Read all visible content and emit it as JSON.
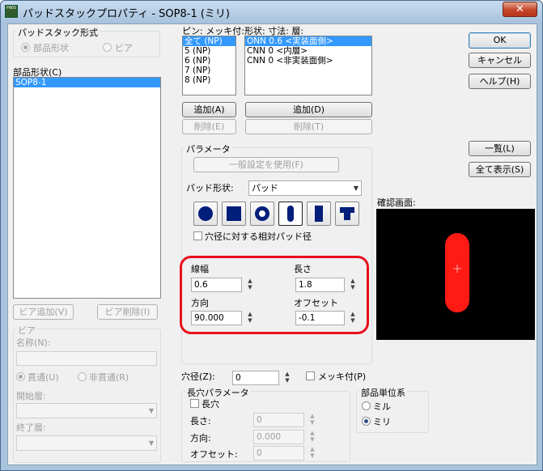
{
  "window": {
    "title": "パッドスタックプロパティ - SOP8-1 (ミリ)",
    "app_icon_text": "PADS",
    "close_glyph": "✕"
  },
  "padstack_type": {
    "group_label": "パッドスタック形式",
    "options": [
      "部品形状",
      "ビア"
    ],
    "selected": "部品形状"
  },
  "decal": {
    "label": "部品形状(C)",
    "items": [
      "SOP8-1"
    ],
    "selected": "SOP8-1"
  },
  "via_buttons": {
    "add": "ビア追加(V)",
    "delete": "ビア削除(I)"
  },
  "via_group": {
    "label": "ビア",
    "name_label": "名称(N):",
    "name_value": "",
    "through": "貫通(U)",
    "non_through": "非貫通(R)",
    "selected": "貫通(U)",
    "start_layer_label": "開始層:",
    "start_layer_value": "",
    "end_layer_label": "終了層:",
    "end_layer_value": ""
  },
  "pins": {
    "label": "ピン: メッキ付:",
    "items": [
      "全て (NP)",
      "5 (NP)",
      "6 (NP)",
      "7 (NP)",
      "8 (NP)"
    ],
    "selected": "全て (NP)"
  },
  "shapes": {
    "label": "形状: 寸法: 層:",
    "items": [
      "ONN 0.6 <実装面側>",
      "CNN 0 <内層>",
      "CNN 0 <非実装面側>"
    ],
    "selected": "ONN 0.6 <実装面側>"
  },
  "pins_buttons": {
    "add": "追加(A)",
    "delete": "削除(E)"
  },
  "shapes_buttons": {
    "add": "追加(D)",
    "delete": "削除(T)"
  },
  "actions": {
    "ok": "OK",
    "cancel": "キャンセル",
    "help": "ヘルプ(H)",
    "list": "一覧(L)",
    "show_all": "全て表示(S)"
  },
  "params": {
    "group_label": "パラメータ",
    "use_general": "一般設定を使用(F)",
    "pad_shape_label": "パッド形状:",
    "pad_shape_value": "パッド",
    "shape_icons": [
      "round-pad-icon",
      "square-pad-icon",
      "annular-pad-icon",
      "oval-pad-icon",
      "rectangle-pad-icon",
      "odd-pad-icon"
    ],
    "active_shape": "oval-pad-icon",
    "relative_drill": "穴径に対する相対パッド径",
    "width_label": "線幅",
    "width_value": "0.6",
    "length_label": "長さ",
    "length_value": "1.8",
    "orientation_label": "方向",
    "orientation_value": "90.000",
    "offset_label": "オフセット",
    "offset_value": "-0.1"
  },
  "preview": {
    "label": "確認画面:"
  },
  "drill": {
    "label": "穴径(Z):",
    "value": "0",
    "plated_label": "メッキ付(P)"
  },
  "slot": {
    "group_label": "長穴パラメータ",
    "slot_checkbox": "長穴",
    "length_label": "長さ:",
    "length_value": "0",
    "orientation_label": "方向:",
    "orientation_value": "0.000",
    "offset_label": "オフセット:",
    "offset_value": "0"
  },
  "units": {
    "group_label": "部品単位系",
    "options": [
      "ミル",
      "ミリ"
    ],
    "selected": "ミリ"
  },
  "colors": {
    "pad": "#ff1a14",
    "selection": "#3399ff",
    "highlight": "#e8101b",
    "title_bar": "#a9c3de"
  }
}
